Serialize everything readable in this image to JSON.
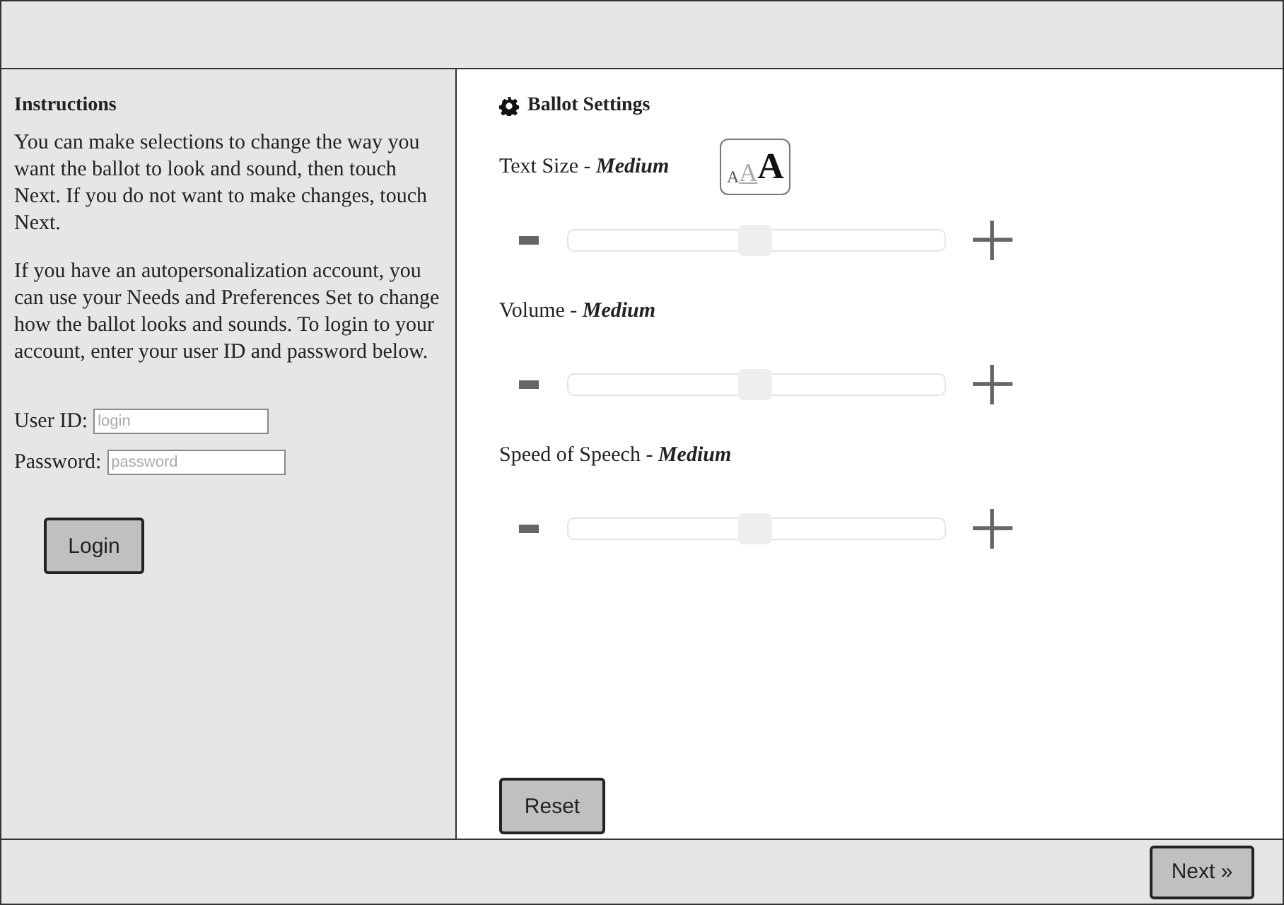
{
  "instructions": {
    "title": "Instructions",
    "paragraphs": [
      "You can make selections to change the way you want the ballot to look and sound, then touch Next. If you do not want to make changes, touch Next.",
      "If you have an autopersonalization account, you can use your Needs and Preferences Set to change how the ballot looks and sounds. To login to your account, enter your user ID and password below."
    ],
    "fields": [
      {
        "label": "User ID:",
        "placeholder": "login"
      },
      {
        "label": "Password:",
        "placeholder": "password"
      }
    ],
    "login_button": "Login"
  },
  "settings": {
    "title": "Ballot Settings",
    "text_size_icon": [
      "A",
      "A",
      "A"
    ],
    "controls": [
      {
        "label": "Text Size -",
        "value": "Medium",
        "level": 0.5
      },
      {
        "label": "Volume -",
        "value": "Medium",
        "level": 0.5
      },
      {
        "label": "Speed of Speech -",
        "value": "Medium",
        "level": 0.5
      }
    ],
    "reset_button": "Reset"
  },
  "next_button": "Next »"
}
